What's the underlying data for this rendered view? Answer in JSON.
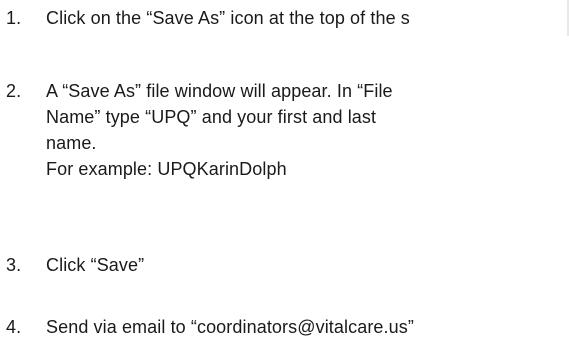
{
  "steps": [
    {
      "number": "1.",
      "lines": [
        "Click on the “Save As” icon at the top of the s"
      ]
    },
    {
      "number": "2.",
      "lines": [
        "A “Save As” file window will appear.  In “File",
        "Name” type “UPQ” and your first and last",
        "name.",
        "For example: UPQKarinDolph"
      ]
    },
    {
      "number": "3.",
      "lines": [
        "Click “Save”"
      ]
    },
    {
      "number": "4.",
      "lines": [
        "Send via email to “coordinators@vitalcare.us”"
      ]
    }
  ]
}
